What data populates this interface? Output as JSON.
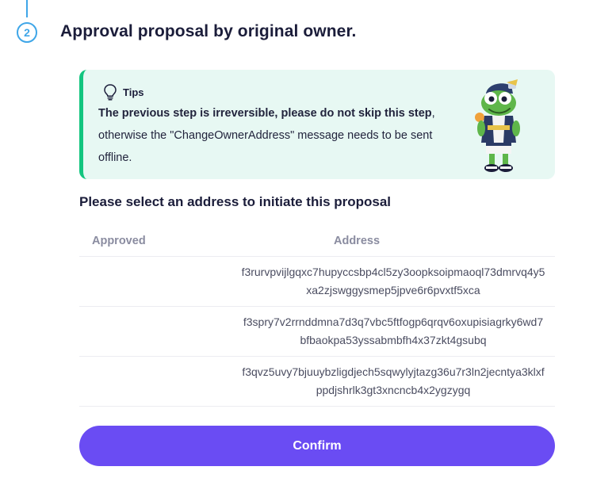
{
  "step": {
    "number": "2",
    "title": "Approval proposal by original owner."
  },
  "tips": {
    "label": "Tips",
    "bold_text": "The previous step is irreversible, please do not skip this step",
    "normal_text": ", otherwise the \"ChangeOwnerAddress\" message needs to be sent offline."
  },
  "select_title": "Please select an address to initiate this proposal",
  "table": {
    "headers": {
      "approved": "Approved",
      "address": "Address"
    },
    "rows": [
      {
        "approved": "",
        "address": "f3rurvpvijlgqxc7hupyccsbp4cl5zy3oopksoipmaoql73dmrvq4y5xa2zjswggysmep5jpve6r6pvxtf5xca"
      },
      {
        "approved": "",
        "address": "f3spry7v2rrnddmna7d3q7vbc5ftfogp6qrqv6oxupisiagrky6wd7bfbaokpa53yssabmbfh4x37zkt4gsubq"
      },
      {
        "approved": "",
        "address": "f3qvz5uvy7bjuuybzligdjech5sqwylyjtazg36u7r3ln2jecntya3klxfppdjshrlk3gt3xncncb4x2ygzygq"
      }
    ]
  },
  "confirm_label": "Confirm",
  "colors": {
    "accent": "#6a4cf3",
    "step": "#3fa6e8",
    "tips_bg": "#e7f8f3",
    "tips_border": "#12c57f"
  },
  "icons": {
    "tips": "lightbulb-icon",
    "mascot": "frog-mascot"
  }
}
